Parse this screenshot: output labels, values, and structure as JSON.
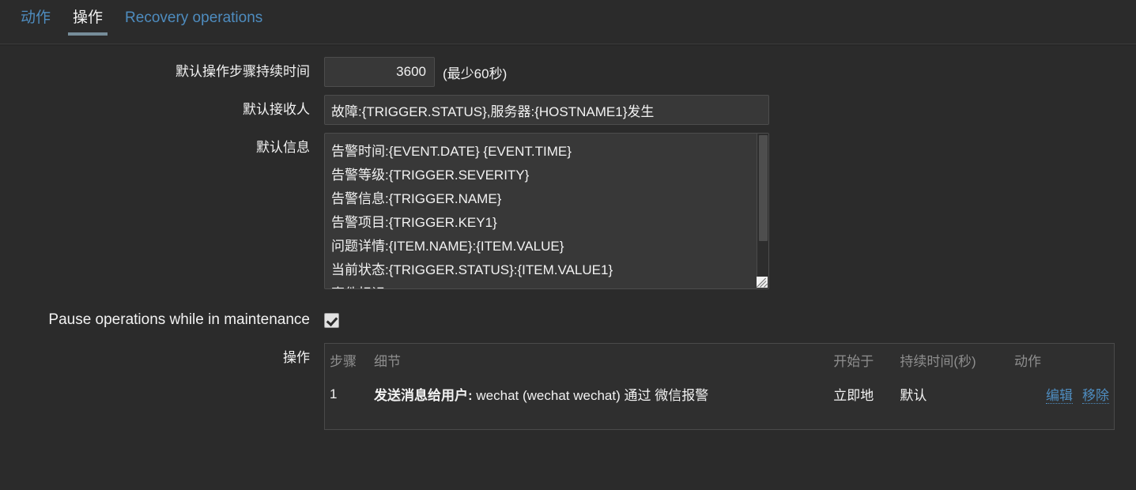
{
  "tabs": [
    {
      "label": "动作",
      "active": false
    },
    {
      "label": "操作",
      "active": true
    },
    {
      "label": "Recovery operations",
      "active": false
    }
  ],
  "form": {
    "default_step_duration": {
      "label": "默认操作步骤持续时间",
      "value": "3600",
      "hint": "(最少60秒)"
    },
    "default_subject": {
      "label": "默认接收人",
      "value": "故障:{TRIGGER.STATUS},服务器:{HOSTNAME1}发生"
    },
    "default_message": {
      "label": "默认信息",
      "value": "告警时间:{EVENT.DATE} {EVENT.TIME}\n告警等级:{TRIGGER.SEVERITY}\n告警信息:{TRIGGER.NAME}\n告警项目:{TRIGGER.KEY1}\n问题详情:{ITEM.NAME}:{ITEM.VALUE}\n当前状态:{TRIGGER.STATUS}:{ITEM.VALUE1}\n事件标识:{EVENT.ID}"
    },
    "pause_operations": {
      "label": "Pause operations while in maintenance",
      "checked": true
    },
    "operations": {
      "label": "操作",
      "columns": {
        "step": "步骤",
        "details": "细节",
        "start_in": "开始于",
        "duration": "持续时间(秒)",
        "action": "动作"
      },
      "rows": [
        {
          "step": "1",
          "details_bold": "发送消息给用户:",
          "details_rest": "wechat (wechat wechat) 通过 微信报警",
          "start_in": "立即地",
          "duration": "默认",
          "edit_label": "编辑",
          "remove_label": "移除"
        }
      ]
    }
  },
  "colors": {
    "background": "#2B2B2B",
    "link": "#4E8CBF",
    "text": "#F2F2F2",
    "muted": "#8E8E8E",
    "input_bg": "#383838",
    "tab_underline": "#768D99"
  }
}
